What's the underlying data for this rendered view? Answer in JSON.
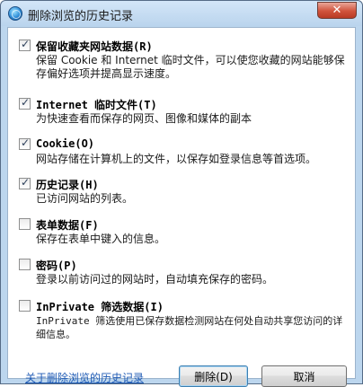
{
  "window": {
    "title": "删除浏览的历史记录",
    "close_glyph": "✕",
    "icon": "internet-explorer-icon"
  },
  "options": [
    {
      "title": "保留收藏夹网站数据(R)",
      "checked": true,
      "description": "保留 Cookie 和 Internet 临时文件，可以使您收藏的网站能够保存偏好选项并提高显示速度。"
    },
    {
      "title": "Internet 临时文件(T)",
      "checked": true,
      "description": "为快速查看而保存的网页、图像和媒体的副本"
    },
    {
      "title": "Cookie(O)",
      "checked": true,
      "description": "网站存储在计算机上的文件，以保存如登录信息等首选项。"
    },
    {
      "title": "历史记录(H)",
      "checked": true,
      "description": "已访问网站的列表。"
    },
    {
      "title": "表单数据(F)",
      "checked": false,
      "description": "保存在表单中键入的信息。"
    },
    {
      "title": "密码(P)",
      "checked": false,
      "description": "登录以前访问过的网站时，自动填充保存的密码。"
    },
    {
      "title": "InPrivate 筛选数据(I)",
      "checked": false,
      "description": "InPrivate 筛选使用已保存数据检测网站在何处自动共享您访问的详细信息。"
    }
  ],
  "footer": {
    "link_text": "关于删除浏览的历史记录",
    "delete_label": "删除(D)",
    "cancel_label": "取消"
  }
}
